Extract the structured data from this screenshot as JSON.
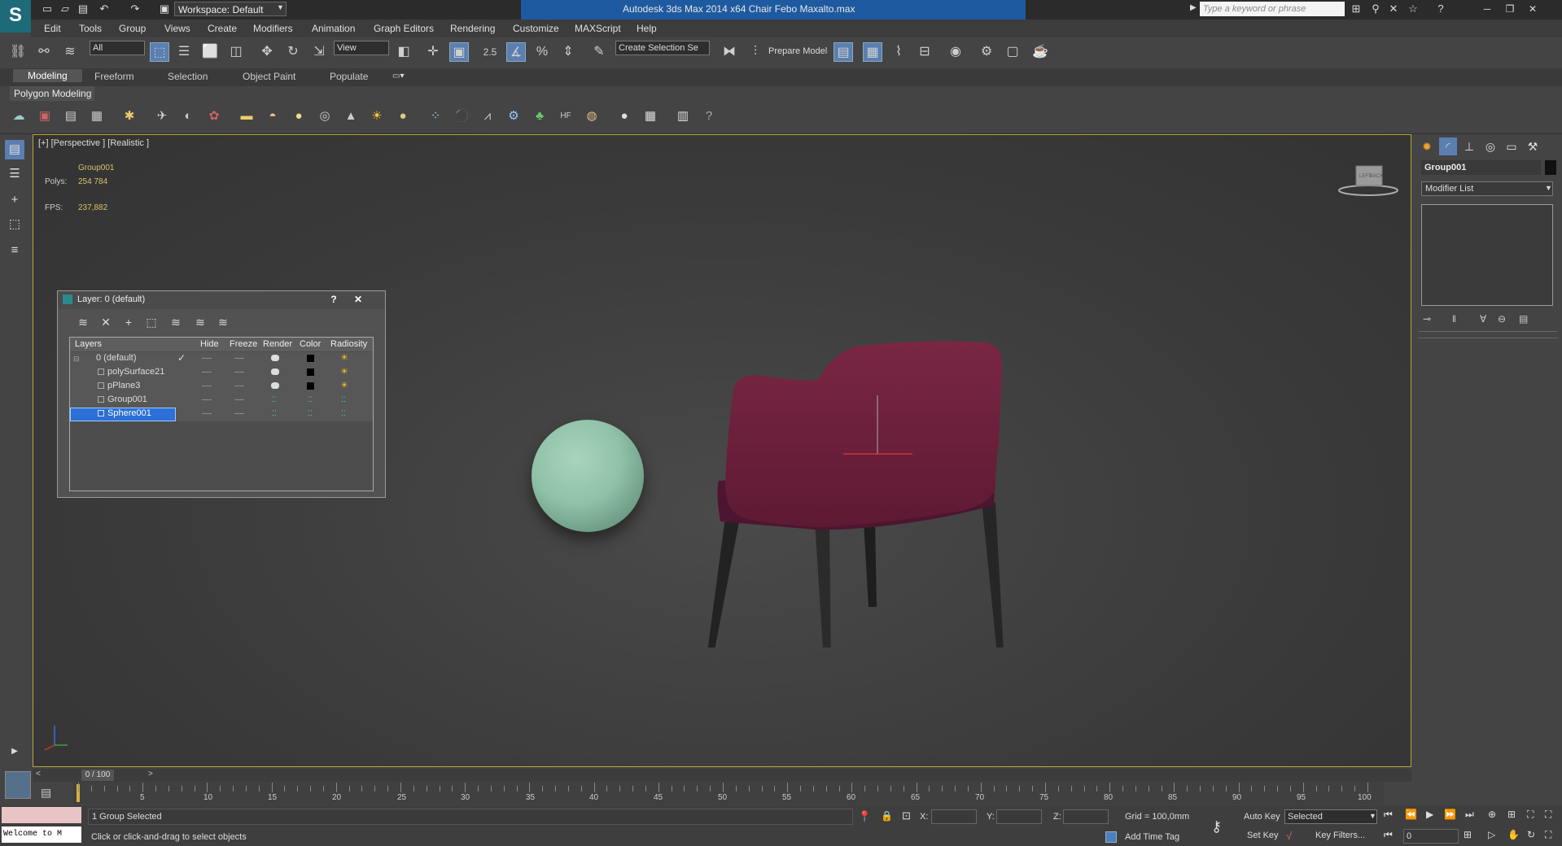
{
  "titlebar": {
    "app_title": "Autodesk 3ds Max  2014 x64     Chair Febo Maxalto.max",
    "workspace": "Workspace: Default",
    "search_placeholder": "Type a keyword or phrase"
  },
  "menu": [
    "Edit",
    "Tools",
    "Group",
    "Views",
    "Create",
    "Modifiers",
    "Animation",
    "Graph Editors",
    "Rendering",
    "Customize",
    "MAXScript",
    "Help"
  ],
  "toolbar": {
    "filter": "All",
    "ref_coord": "View",
    "snap_value": "2.5",
    "selection_set": "Create Selection Se",
    "prepare_model": "Prepare Model"
  },
  "ribbon": {
    "tabs": [
      "Modeling",
      "Freeform",
      "Selection",
      "Object Paint",
      "Populate"
    ],
    "active_tab": "Modeling",
    "panel": "Polygon Modeling"
  },
  "viewport": {
    "label": "[+] [Perspective ] [Realistic ]",
    "selected_name": "Group001",
    "polys_label": "Polys:",
    "polys_value": "254 784",
    "fps_label": "FPS:",
    "fps_value": "237,882",
    "viewcube_labels": {
      "left": "LEFT",
      "back": "BACK"
    }
  },
  "layer_dialog": {
    "title": "Layer: 0 (default)",
    "help": "?",
    "close": "✕",
    "columns": [
      "Layers",
      "Hide",
      "Freeze",
      "Render",
      "Color",
      "Radiosity"
    ],
    "rows": [
      {
        "name": "0 (default)",
        "hide": "----",
        "freeze": "----",
        "selected": false,
        "current": true
      },
      {
        "name": "polySurface21",
        "hide": "----",
        "freeze": "----",
        "selected": false,
        "current": false
      },
      {
        "name": "pPlane3",
        "hide": "----",
        "freeze": "----",
        "selected": false,
        "current": false
      },
      {
        "name": "Group001",
        "hide": "----",
        "freeze": "----",
        "selected": false,
        "current": false
      },
      {
        "name": "Sphere001",
        "hide": "----",
        "freeze": "----",
        "selected": true,
        "current": false
      }
    ]
  },
  "command_panel": {
    "object_name": "Group001",
    "modifier_list": "Modifier List"
  },
  "timeline": {
    "frame": "0 / 100",
    "ticks": [
      "5",
      "10",
      "15",
      "20",
      "25",
      "30",
      "35",
      "40",
      "45",
      "50",
      "55",
      "60",
      "65",
      "70",
      "75",
      "80",
      "85",
      "90",
      "95",
      "100"
    ]
  },
  "status": {
    "maxscript": "Welcome to M",
    "selection": "1 Group Selected",
    "prompt": "Click or click-and-drag to select objects",
    "x_label": "X:",
    "y_label": "Y:",
    "z_label": "Z:",
    "grid": "Grid = 100,0mm",
    "add_time_tag": "Add Time Tag",
    "auto_key": "Auto Key",
    "set_key": "Set Key",
    "key_mode": "Selected",
    "key_filters": "Key Filters...",
    "frame_field": "0"
  },
  "colors": {
    "accent": "#1e5aa0",
    "chair": "#6b1f3a",
    "sphere": "#8fc2a8",
    "selected_row": "#2c6fd6",
    "viewport_border": "#b5a63a"
  }
}
